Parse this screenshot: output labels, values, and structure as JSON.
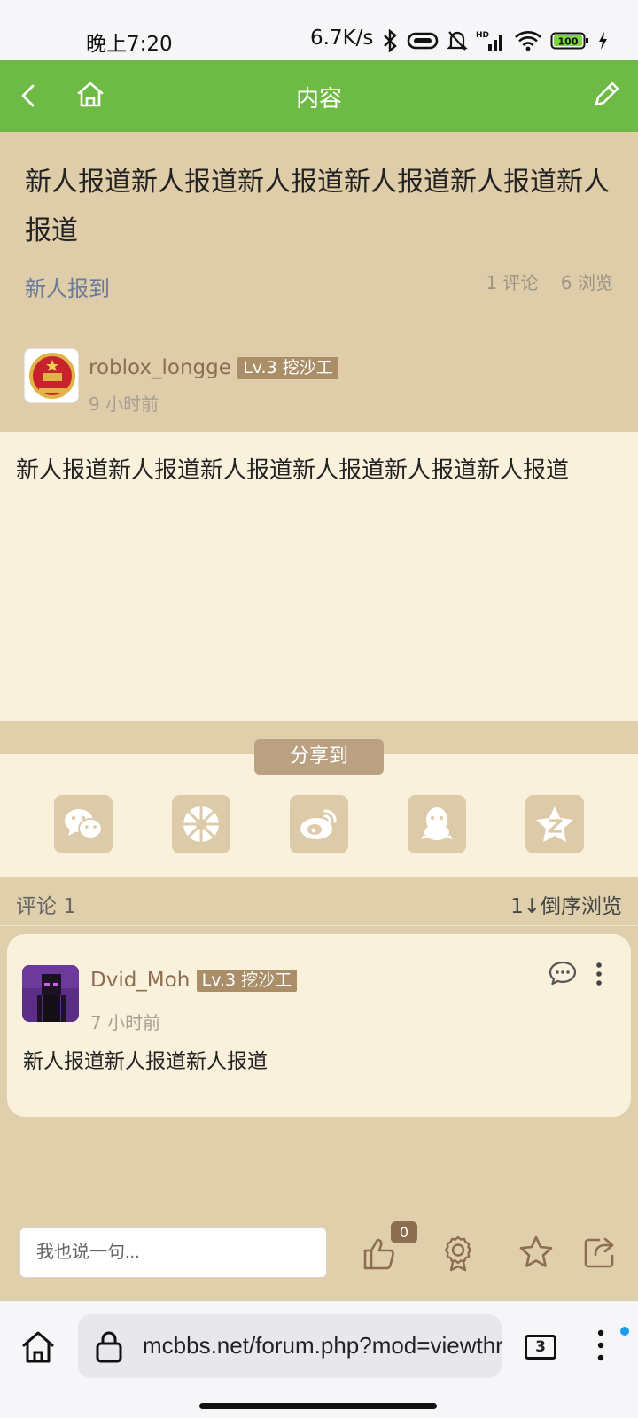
{
  "status_bar": {
    "time": "晚上7:20",
    "network_speed": "6.7K/s",
    "battery": "100",
    "icons": [
      "bluetooth-icon",
      "vibrate-icon",
      "bell-off-icon",
      "hd-signal-icon",
      "wifi-icon",
      "battery-icon",
      "charging-icon"
    ]
  },
  "app_bar": {
    "title": "内容",
    "back_icon": "chevron-left-icon",
    "home_icon": "home-icon",
    "edit_icon": "pencil-icon"
  },
  "post": {
    "title": "新人报道新人报道新人报道新人报道新人报道新人报道",
    "category": "新人报到",
    "comments": "1 评论",
    "views": "6 浏览",
    "author": "roblox_longge",
    "level": "Lv.3 挖沙工",
    "time": "9 小时前",
    "body": "新人报道新人报道新人报道新人报道新人报道新人报道"
  },
  "share": {
    "label": "分享到",
    "targets": [
      "wechat-icon",
      "moments-icon",
      "weibo-icon",
      "qq-icon",
      "qzone-icon"
    ]
  },
  "comments_section": {
    "count_label": "评论 1",
    "order_label": "1↓倒序浏览"
  },
  "comments": [
    {
      "author": "Dvid_Moh",
      "level": "Lv.3 挖沙工",
      "time": "7 小时前",
      "text": "新人报道新人报道新人报道"
    }
  ],
  "reply_bar": {
    "placeholder": "我也说一句...",
    "like_count": "0"
  },
  "browser": {
    "url": "mcbbs.net/forum.php?mod=viewthread",
    "tab_count": "3"
  },
  "colors": {
    "app_bar": "#6dbb44",
    "header_bg": "#dfcca8",
    "content_bg": "#faf1dc",
    "accent_brown": "#8d6d50"
  }
}
